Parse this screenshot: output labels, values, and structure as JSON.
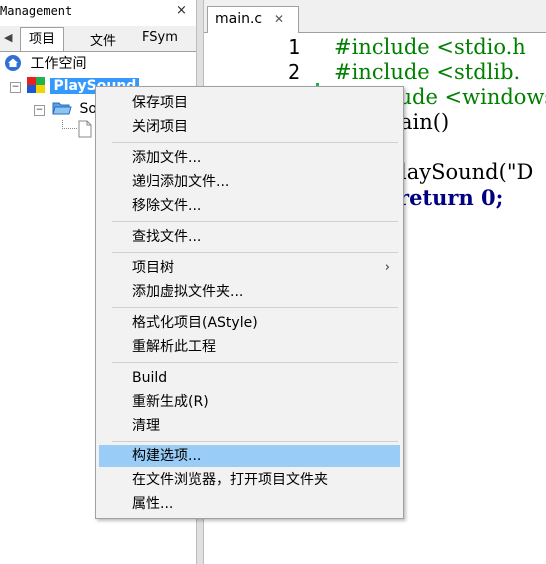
{
  "management": {
    "title": "Management",
    "close": "×",
    "tabs": [
      {
        "label": "项目",
        "active": true
      },
      {
        "label": "文件",
        "active": false
      },
      {
        "label": "FSym",
        "active": false
      }
    ],
    "tab_left_arrow": "◀",
    "tree": {
      "workspace": "工作空间",
      "project": "PlaySound",
      "folder": "So",
      "expander_minus": "−"
    }
  },
  "editor": {
    "tab_label": "main.c",
    "tab_close": "✕",
    "line_numbers": [
      "1",
      "2"
    ],
    "code": [
      {
        "text": "#include <stdio.h",
        "color": "#008000"
      },
      {
        "text": "#include <stdlib.",
        "color": "#008000"
      },
      {
        "text": "clude <windows",
        "color": "#008000"
      },
      {
        "text": "ain()",
        "color": "#000000"
      },
      {
        "text": "laySound(\"D",
        "color": "#000000"
      },
      {
        "text": "return 0;",
        "color": "#000080"
      }
    ]
  },
  "context_menu": {
    "items": [
      {
        "label": "保存项目"
      },
      {
        "label": "关闭项目"
      },
      {
        "label": "添加文件..."
      },
      {
        "label": "递归添加文件..."
      },
      {
        "label": "移除文件..."
      },
      {
        "label": "查找文件..."
      },
      {
        "label": "项目树",
        "submenu_arrow": "›"
      },
      {
        "label": "添加虚拟文件夹..."
      },
      {
        "label": "格式化项目(AStyle)"
      },
      {
        "label": "重解析此工程"
      },
      {
        "label": "Build"
      },
      {
        "label": "重新生成(R)"
      },
      {
        "label": "清理"
      },
      {
        "label": "构建选项...",
        "highlighted": true
      },
      {
        "label": "在文件浏览器，打开项目文件夹"
      },
      {
        "label": "属性..."
      }
    ]
  },
  "colors": {
    "selection": "#3399ff",
    "menu_highlight": "#99ccf6",
    "include_green": "#008000",
    "keyword_navy": "#000080",
    "number_orange": "#ff8000",
    "paren_red": "#ff0000",
    "string_blue": "#0000ff"
  }
}
